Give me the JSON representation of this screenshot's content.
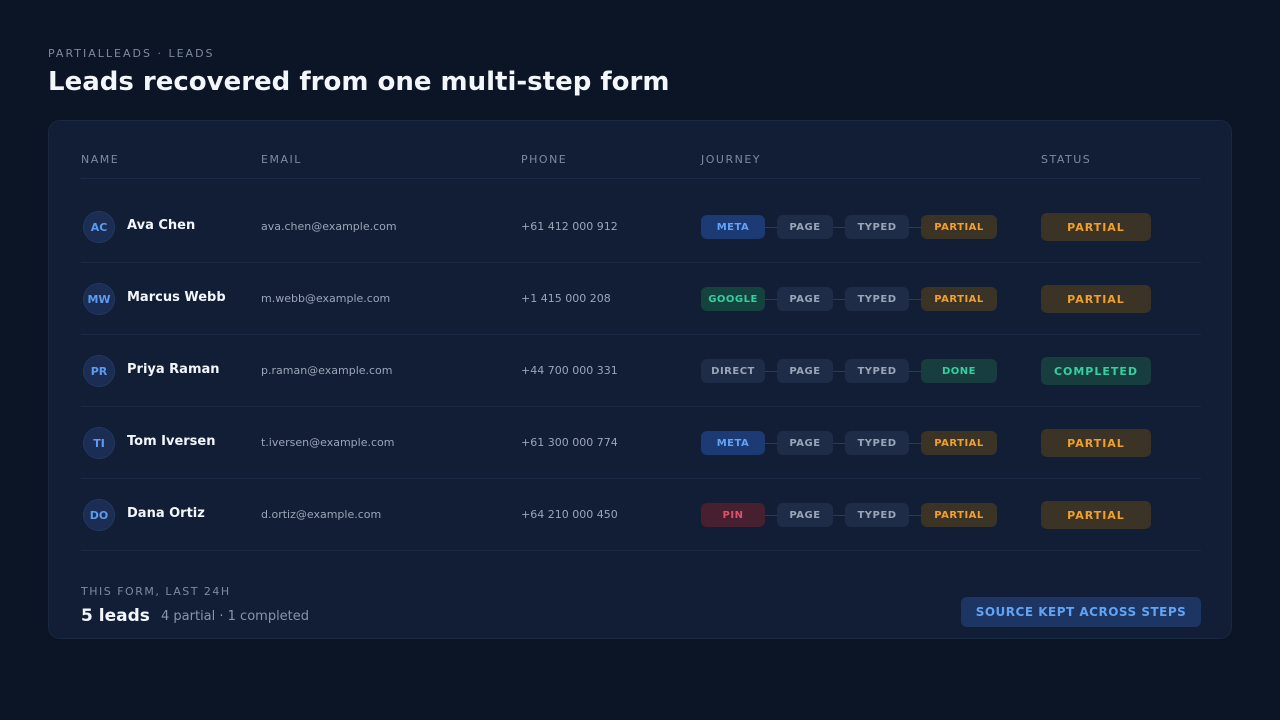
{
  "header": {
    "eyebrow": "PARTIALLEADS · LEADS",
    "title": "Leads recovered from one multi-step form"
  },
  "table": {
    "columns": [
      "NAME",
      "EMAIL",
      "PHONE",
      "JOURNEY",
      "STATUS"
    ],
    "rows": [
      {
        "initials": "AC",
        "name": "Ava Chen",
        "email": "ava.chen@example.com",
        "phone": "+61 412 000 912",
        "journey": [
          {
            "label": "META",
            "kind": "meta"
          },
          {
            "label": "PAGE",
            "kind": "step"
          },
          {
            "label": "TYPED",
            "kind": "step"
          },
          {
            "label": "PARTIAL",
            "kind": "partial"
          }
        ],
        "status": "PARTIAL",
        "status_kind": "partial"
      },
      {
        "initials": "MW",
        "name": "Marcus Webb",
        "email": "m.webb@example.com",
        "phone": "+1 415 000 208",
        "journey": [
          {
            "label": "GOOGLE",
            "kind": "google"
          },
          {
            "label": "PAGE",
            "kind": "step"
          },
          {
            "label": "TYPED",
            "kind": "step"
          },
          {
            "label": "PARTIAL",
            "kind": "partial"
          }
        ],
        "status": "PARTIAL",
        "status_kind": "partial"
      },
      {
        "initials": "PR",
        "name": "Priya Raman",
        "email": "p.raman@example.com",
        "phone": "+44 700 000 331",
        "journey": [
          {
            "label": "DIRECT",
            "kind": "direct"
          },
          {
            "label": "PAGE",
            "kind": "step"
          },
          {
            "label": "TYPED",
            "kind": "step"
          },
          {
            "label": "DONE",
            "kind": "done"
          }
        ],
        "status": "COMPLETED",
        "status_kind": "done"
      },
      {
        "initials": "TI",
        "name": "Tom Iversen",
        "email": "t.iversen@example.com",
        "phone": "+61 300 000 774",
        "journey": [
          {
            "label": "META",
            "kind": "meta"
          },
          {
            "label": "PAGE",
            "kind": "step"
          },
          {
            "label": "TYPED",
            "kind": "step"
          },
          {
            "label": "PARTIAL",
            "kind": "partial"
          }
        ],
        "status": "PARTIAL",
        "status_kind": "partial"
      },
      {
        "initials": "DO",
        "name": "Dana Ortiz",
        "email": "d.ortiz@example.com",
        "phone": "+64 210 000 450",
        "journey": [
          {
            "label": "PIN",
            "kind": "pin"
          },
          {
            "label": "PAGE",
            "kind": "step"
          },
          {
            "label": "TYPED",
            "kind": "step"
          },
          {
            "label": "PARTIAL",
            "kind": "partial"
          }
        ],
        "status": "PARTIAL",
        "status_kind": "partial"
      }
    ]
  },
  "footer": {
    "label": "THIS FORM, LAST 24H",
    "count": "5 leads",
    "summary": "4 partial · 1 completed",
    "button_label": "SOURCE KEPT ACROSS STEPS"
  },
  "colors": {
    "background": "#0b1526",
    "card": "#121e36",
    "accent_blue": "#62a4f3",
    "partial_orange": "#f0a02c",
    "done_green": "#34d1a0",
    "pin_red": "#e0506a"
  }
}
